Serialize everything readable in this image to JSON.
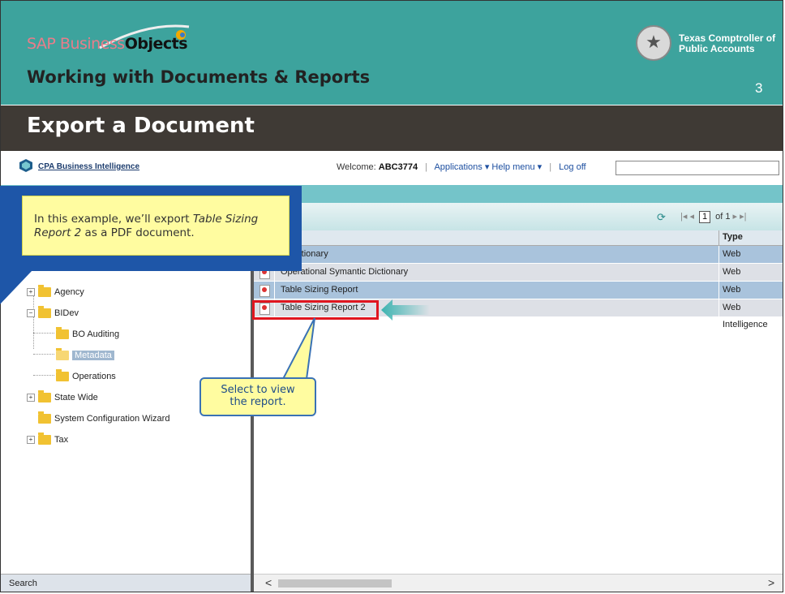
{
  "banner": {
    "brand_part1": "SAP Business",
    "brand_part2": "Objects",
    "subtitle": "Working with Documents & Reports",
    "org_line1": "Texas Comptroller of",
    "org_line2": "Public Accounts",
    "page_number": "3"
  },
  "page_title": "Export a Document",
  "app": {
    "name": "CPA Business Intelligence",
    "welcome_label": "Welcome:",
    "user": "ABC3774",
    "applications": "Applications ▾",
    "help_menu": "Help menu ▾",
    "log_off": "Log off",
    "search_value": ""
  },
  "tree": {
    "items": [
      {
        "label": "Agency"
      },
      {
        "label": "BIDev"
      },
      {
        "label": "BO Auditing"
      },
      {
        "label": "Metadata"
      },
      {
        "label": "Operations"
      },
      {
        "label": "State Wide"
      },
      {
        "label": "System Configuration Wizard"
      },
      {
        "label": "Tax"
      }
    ],
    "search_tab": "Search"
  },
  "list": {
    "refresh_icon": "refresh-icon",
    "page_current": "1",
    "page_total": "of 1",
    "col_type": "Type",
    "rows": [
      {
        "name": "A Dictionary",
        "type": "Web Intelligence"
      },
      {
        "name": "Operational Symantic Dictionary",
        "type": "Web Intelligence"
      },
      {
        "name": "Table Sizing Report",
        "type": "Web Intelligence"
      },
      {
        "name": "Table Sizing Report 2",
        "type": "Web Intelligence"
      }
    ]
  },
  "callout_top": {
    "text_before": "In this example, we’ll export ",
    "text_italic": "Table Sizing Report 2",
    "text_after": " as a PDF document."
  },
  "callout_select": {
    "line1": "Select to view",
    "line2": "the report."
  },
  "colors": {
    "banner": "#3da39d",
    "title_bar": "#3f3a35",
    "highlight": "#e0161f",
    "callout_fill": "#fffca0"
  }
}
